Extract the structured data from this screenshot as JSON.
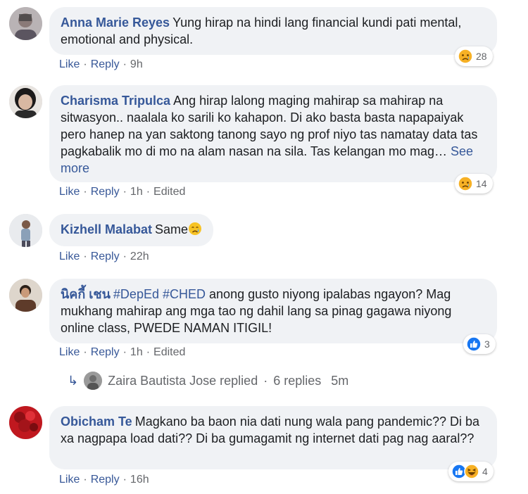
{
  "comments": [
    {
      "author": "Anna Marie Reyes",
      "text": "Yung hirap na hindi lang financial kundi pati mental, emotional and physical.",
      "like": "Like",
      "reply": "Reply",
      "time": "9h",
      "reaction_count": "28",
      "reaction_icon": "sad-face-icon"
    },
    {
      "author": "Charisma Tripulca",
      "text": "Ang hirap lalong maging mahirap sa mahirap na sitwasyon.. naalala ko sarili ko kahapon. Di ako basta basta napapaiyak pero hanep na yan saktong tanong sayo ng prof niyo tas namatay data tas pagkabalik mo di mo na alam nasan na sila. Tas kelangan mo mag…",
      "see_more": "See more",
      "like": "Like",
      "reply": "Reply",
      "time": "1h",
      "edited": "Edited",
      "reaction_count": "14",
      "reaction_icon": "sad-face-icon"
    },
    {
      "author": "Kizhell Malabat",
      "text": "Same",
      "emoji": "crying-face-icon",
      "like": "Like",
      "reply": "Reply",
      "time": "22h"
    },
    {
      "author": "นิคกี้ เชน",
      "tags": [
        "#DepEd",
        "#CHED"
      ],
      "text": "anong gusto niyong ipalabas ngayon? Mag mukhang mahirap ang mga tao ng dahil lang sa pinag gagawa niyong online class, PWEDE NAMAN ITIGIL!",
      "like": "Like",
      "reply": "Reply",
      "time": "1h",
      "edited": "Edited",
      "reaction_count": "3",
      "reaction_icon": "like-thumb-icon"
    },
    {
      "author": "Obicham Te",
      "text": "Magkano ba baon nia dati nung wala pang pandemic?? Di ba xa nagpapa load dati?? Di ba gumagamit ng internet dati pag nag aaral??",
      "like": "Like",
      "reply": "Reply",
      "time": "16h",
      "reaction_count": "4",
      "reaction_icons": [
        "like-thumb-icon",
        "haha-face-icon"
      ]
    }
  ],
  "replies_row": {
    "name": "Zaira Bautista Jose replied",
    "separator": "·",
    "count": "6 replies",
    "time": "5m"
  },
  "dot": "·",
  "colors": {
    "link": "#365899",
    "bubble": "#f0f2f5",
    "meta": "#65676b",
    "like_blue": "#1877f2",
    "sad_yellow": "#f7b125"
  }
}
